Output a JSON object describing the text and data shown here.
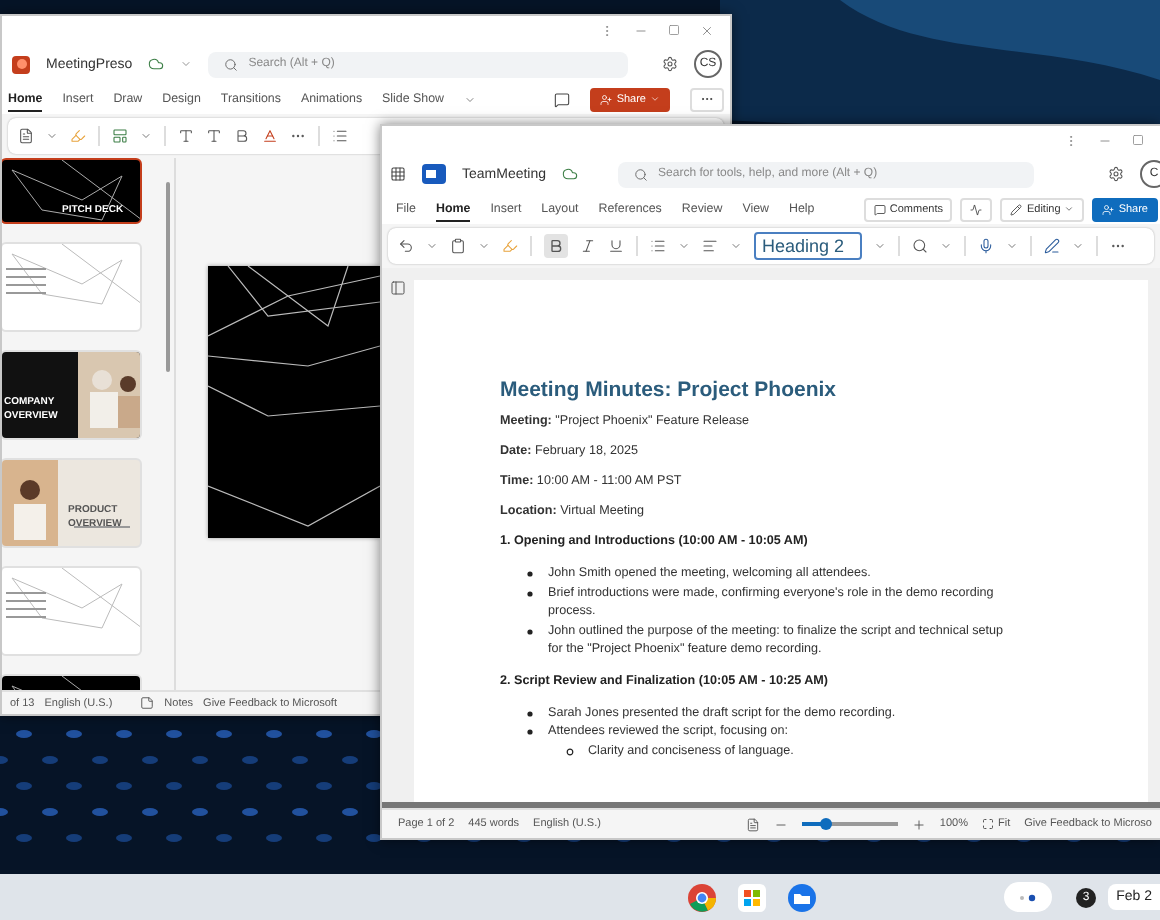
{
  "powerpoint": {
    "title": "MeetingPreso",
    "search": {
      "placeholder": "Search (Alt + Q)"
    },
    "avatar": "CS",
    "tabs": [
      {
        "label": "Home",
        "selected": true
      },
      {
        "label": "Insert",
        "selected": false
      },
      {
        "label": "Draw",
        "selected": false
      },
      {
        "label": "Design",
        "selected": false
      },
      {
        "label": "Transitions",
        "selected": false
      },
      {
        "label": "Animations",
        "selected": false
      },
      {
        "label": "Slide Show",
        "selected": false
      }
    ],
    "share": "Share",
    "slides": [
      {
        "kind": "dark",
        "title": "PITCH DECK",
        "selected": true
      },
      {
        "kind": "light",
        "selected": false
      },
      {
        "kind": "photo-dark",
        "title": "COMPANY OVERVIEW",
        "selected": false
      },
      {
        "kind": "photo-light",
        "title": "PRODUCT OVERVIEW",
        "selected": false
      },
      {
        "kind": "light",
        "selected": false
      },
      {
        "kind": "dark",
        "selected": false
      }
    ],
    "status": {
      "slide": "of 13",
      "language": "English (U.S.)",
      "notes": "Notes",
      "feedback": "Give Feedback to Microsoft"
    }
  },
  "word": {
    "title": "TeamMeeting",
    "search": {
      "placeholder": "Search for tools, help, and more (Alt + Q)"
    },
    "avatar": "C",
    "tabs": [
      {
        "label": "File",
        "selected": false
      },
      {
        "label": "Home",
        "selected": true
      },
      {
        "label": "Insert",
        "selected": false
      },
      {
        "label": "Layout",
        "selected": false
      },
      {
        "label": "References",
        "selected": false
      },
      {
        "label": "Review",
        "selected": false
      },
      {
        "label": "View",
        "selected": false
      },
      {
        "label": "Help",
        "selected": false
      }
    ],
    "comments": "Comments",
    "editing": "Editing",
    "share": "Share",
    "style": "Heading 2",
    "bold_on": true,
    "document": {
      "heading": "Meeting Minutes: Project Phoenix",
      "blocks": [
        {
          "kind": "para",
          "text": "**Meeting:** \"Project Phoenix\" Feature Release"
        },
        {
          "kind": "para",
          "text": "**Date:** February 18, 2025"
        },
        {
          "kind": "para",
          "text": "**Time:** 10:00 AM - 11:00 AM PST"
        },
        {
          "kind": "para",
          "text": "**Location:** Virtual Meeting"
        },
        {
          "kind": "section",
          "text": "1. Opening and Introductions (10:00 AM - 10:05 AM)"
        },
        {
          "kind": "bullets",
          "items": [
            {
              "text": "John Smith opened the meeting, welcoming all attendees."
            },
            {
              "text": "Brief introductions were made, confirming everyone's role in the demo recording process."
            },
            {
              "text": "John outlined the purpose of the meeting: to finalize the script and technical setup for the \"Project Phoenix\" feature demo recording."
            }
          ]
        },
        {
          "kind": "section",
          "text": "2. Script Review and Finalization (10:05 AM - 10:25 AM)"
        },
        {
          "kind": "bullets",
          "items": [
            {
              "text": "Sarah Jones presented the draft script for the demo recording."
            },
            {
              "text": "Attendees reviewed the script, focusing on:",
              "children": [
                {
                  "text": "Clarity and conciseness of language."
                }
              ]
            }
          ]
        }
      ]
    },
    "status": {
      "page": "Page 1 of 2",
      "words": "445 words",
      "language": "English (U.S.)",
      "zoom": "100%",
      "fit": "Fit",
      "feedback": "Give Feedback to Microso"
    },
    "zoom_slider": {
      "level": 0.25
    }
  },
  "taskbar": {
    "badge": "3",
    "date": "Feb 2"
  }
}
